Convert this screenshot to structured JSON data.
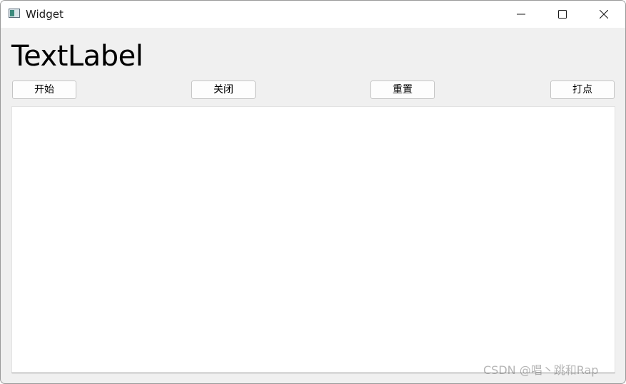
{
  "window": {
    "title": "Widget",
    "icon": "app-window-icon",
    "controls": {
      "minimize_icon": "minimize-icon",
      "maximize_icon": "maximize-icon",
      "close_icon": "close-icon"
    }
  },
  "main": {
    "label": "TextLabel",
    "buttons": [
      "开始",
      "关闭",
      "重置",
      "打点"
    ]
  },
  "watermark": "CSDN @唱丶跳和Rap",
  "colors": {
    "window_bg": "#f0f0f0",
    "titlebar_bg": "#ffffff",
    "canvas_bg": "#ffffff"
  }
}
